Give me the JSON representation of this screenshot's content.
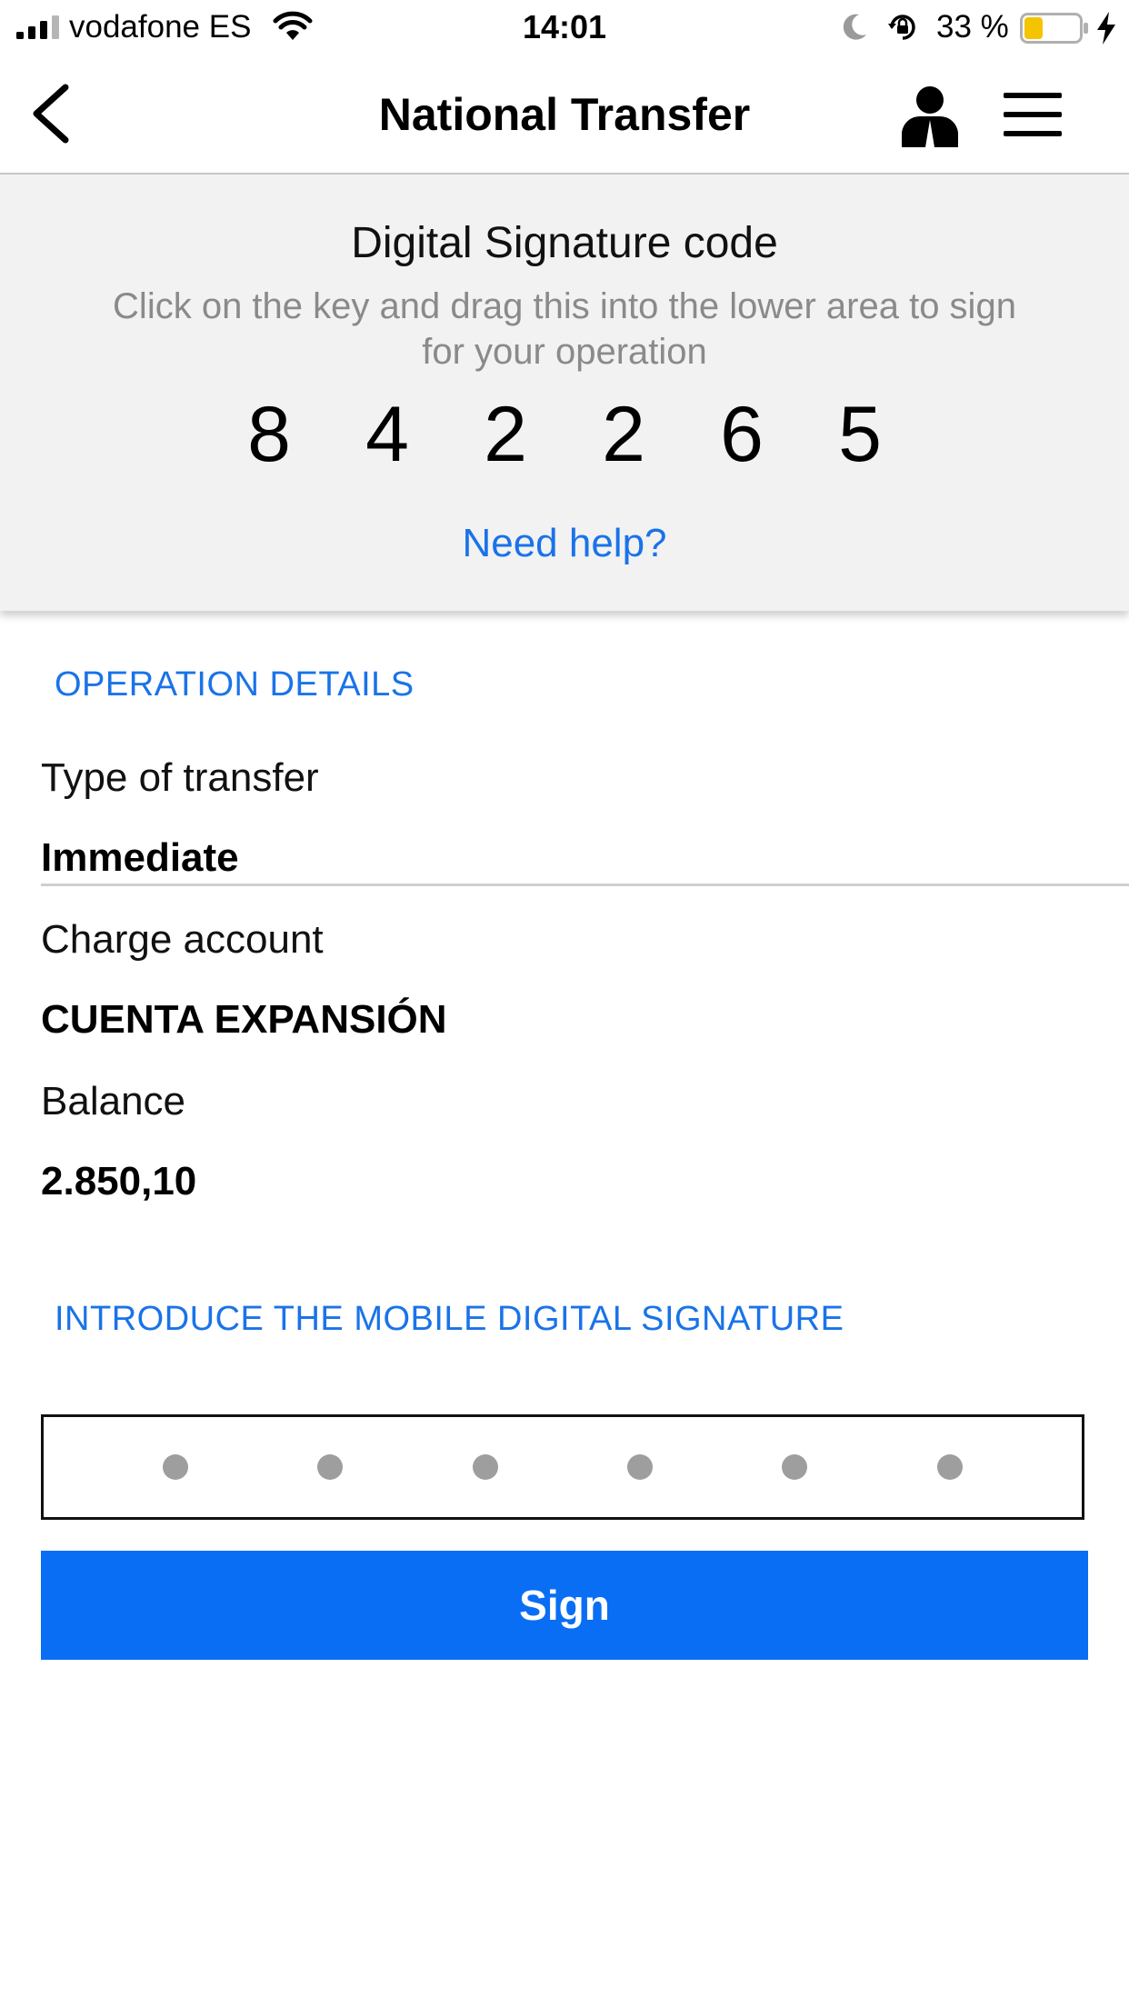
{
  "status_bar": {
    "carrier": "vodafone ES",
    "time": "14:01",
    "battery_percent": "33 %",
    "battery_level": 0.33,
    "battery_color": "#f5c400"
  },
  "nav": {
    "title": "National Transfer",
    "back_icon": "chevron-left-icon",
    "profile_icon": "user-icon",
    "menu_icon": "hamburger-menu-icon"
  },
  "signature_code": {
    "title": "Digital Signature code",
    "instructions": "Click on the key and drag this into the lower area to sign for your operation",
    "digits": [
      "8",
      "4",
      "2",
      "2",
      "6",
      "5"
    ],
    "help_link": "Need help?"
  },
  "operation_details": {
    "section_title": "OPERATION DETAILS",
    "type_label": "Type of transfer",
    "type_value": "Immediate",
    "account_label": "Charge account",
    "account_value": "CUENTA EXPANSIÓN",
    "balance_label": "Balance",
    "balance_value": "2.850,10"
  },
  "signature_input": {
    "section_title": "INTRODUCE THE MOBILE DIGITAL SIGNATURE",
    "slots": 6,
    "filled": 0
  },
  "sign_button": {
    "label": "Sign"
  },
  "colors": {
    "accent": "#1a73e8",
    "button": "#0a6ef5",
    "panel_background": "#f2f2f2",
    "muted_text": "#8a8a8a"
  }
}
